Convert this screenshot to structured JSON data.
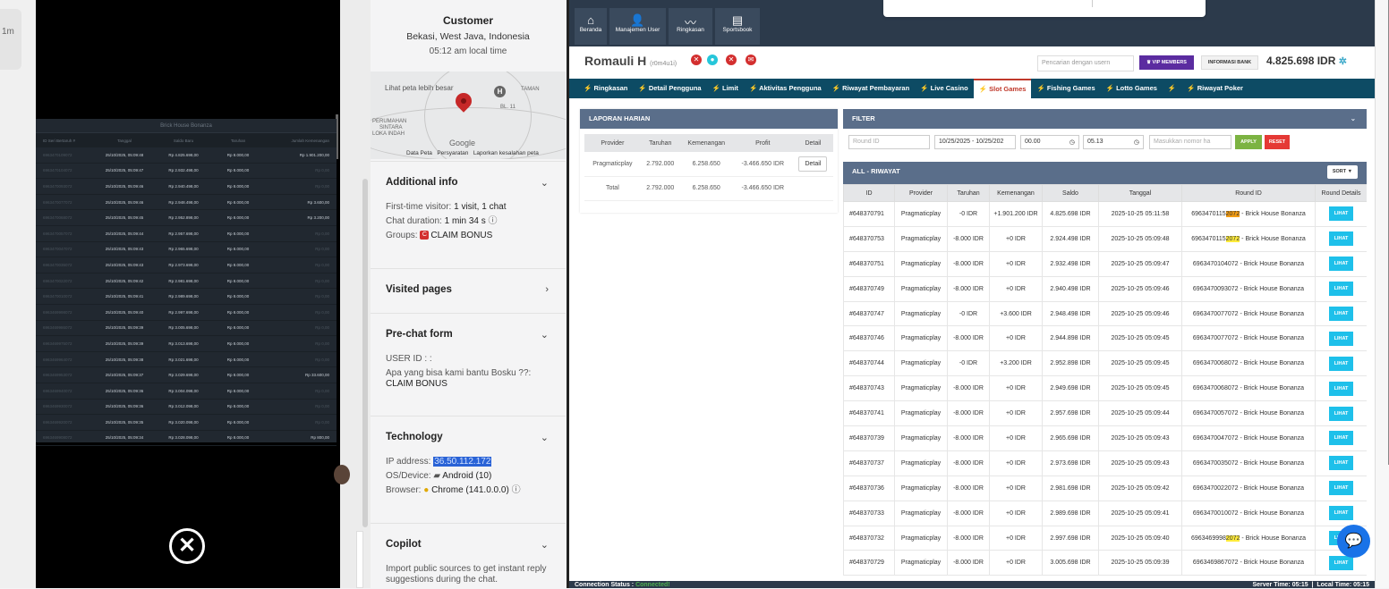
{
  "left_strip": {
    "label": "1m"
  },
  "viewer": {
    "sheet_title": "Brick House Bonanza",
    "headers": [
      "ID Seri Bertaruh #",
      "Tanggal",
      "Saldo Baru",
      "Taruhan",
      "Jumlah Kemenangan"
    ],
    "rows": [
      [
        "6963470109072",
        "25/10/2025, 05:09:48",
        "Rp 4.825.698,00",
        "Rp 8.000,00",
        "Rp 1.901.200,00"
      ],
      [
        "6963470104072",
        "25/10/2025, 05:09:47",
        "Rp 2.932.498,00",
        "Rp 8.000,00",
        "Rp 0,00"
      ],
      [
        "6963470093072",
        "25/10/2025, 05:09:46",
        "Rp 2.940.498,00",
        "Rp 8.000,00",
        "Rp 0,00"
      ],
      [
        "6963470077072",
        "25/10/2025, 05:09:46",
        "Rp 2.948.498,00",
        "Rp 8.000,00",
        "Rp 3.600,00"
      ],
      [
        "6963470068072",
        "25/10/2025, 05:09:45",
        "Rp 2.952.898,00",
        "Rp 8.000,00",
        "Rp 3.200,00"
      ],
      [
        "6963470057072",
        "25/10/2025, 05:09:44",
        "Rp 2.957.698,00",
        "Rp 8.000,00",
        "Rp 0,00"
      ],
      [
        "6963470047072",
        "25/10/2025, 05:09:43",
        "Rp 2.965.698,00",
        "Rp 8.000,00",
        "Rp 0,00"
      ],
      [
        "6963470035072",
        "25/10/2025, 05:09:43",
        "Rp 2.973.698,00",
        "Rp 8.000,00",
        "Rp 0,00"
      ],
      [
        "6963470022072",
        "25/10/2025, 05:09:42",
        "Rp 2.981.698,00",
        "Rp 8.000,00",
        "Rp 0,00"
      ],
      [
        "6963470010072",
        "25/10/2025, 05:09:41",
        "Rp 2.989.698,00",
        "Rp 8.000,00",
        "Rp 0,00"
      ],
      [
        "6963469998072",
        "25/10/2025, 05:09:40",
        "Rp 2.997.698,00",
        "Rp 8.000,00",
        "Rp 0,00"
      ],
      [
        "6963469986072",
        "25/10/2025, 05:09:39",
        "Rp 3.005.698,00",
        "Rp 8.000,00",
        "Rp 0,00"
      ],
      [
        "6963469975072",
        "25/10/2025, 05:09:39",
        "Rp 3.013.698,00",
        "Rp 8.000,00",
        "Rp 0,00"
      ],
      [
        "6963469964072",
        "25/10/2025, 05:09:38",
        "Rp 3.021.698,00",
        "Rp 8.000,00",
        "Rp 0,00"
      ],
      [
        "6963469953072",
        "25/10/2025, 05:09:37",
        "Rp 3.029.698,00",
        "Rp 8.000,00",
        "Rp 33.600,00"
      ],
      [
        "6963469940072",
        "25/10/2025, 05:09:36",
        "Rp 3.004.098,00",
        "Rp 8.000,00",
        "Rp 0,00"
      ],
      [
        "6963469930072",
        "25/10/2025, 05:09:36",
        "Rp 3.012.098,00",
        "Rp 8.000,00",
        "Rp 0,00"
      ],
      [
        "6963469920072",
        "25/10/2025, 05:09:35",
        "Rp 3.020.098,00",
        "Rp 8.000,00",
        "Rp 0,00"
      ],
      [
        "6963469908072",
        "25/10/2025, 05:09:34",
        "Rp 3.028.098,00",
        "Rp 8.000,00",
        "Rp 800,00"
      ]
    ],
    "close_glyph": "✕"
  },
  "visitor": {
    "name": "Customer",
    "location": "Bekasi, West Java, Indonesia",
    "local_time": "05:12 am local time",
    "map": {
      "link": "Lihat peta lebih besar",
      "labels": [
        "TAMAN",
        "BL. 11",
        "PERUMAHAN",
        "SINTARA",
        "LOKA INDAH"
      ],
      "google": "Google",
      "footer": [
        "Data Peta",
        "Persyaratan",
        "Laporkan kesalahan peta"
      ]
    },
    "additional": {
      "title": "Additional info",
      "first_label": "First-time visitor:",
      "first_value": "1 visit, 1 chat",
      "duration_label": "Chat duration:",
      "duration_value": "1 min 34 s",
      "groups_label": "Groups:",
      "groups_value": "CLAIM BONUS"
    },
    "visited": {
      "title": "Visited pages"
    },
    "prechat": {
      "title": "Pre-chat form",
      "user_id": "USER ID : :",
      "question": "Apa yang bisa kami bantu Bosku ??:",
      "answer": "CLAIM BONUS"
    },
    "technology": {
      "title": "Technology",
      "ip_label": "IP address:",
      "ip_value": "36.50.112.172",
      "os_label": "OS/Device:",
      "os_value": "Android (10)",
      "browser_label": "Browser:",
      "browser_value": "Chrome (141.0.0.0)"
    },
    "copilot": {
      "title": "Copilot",
      "text": "Import public sources to get instant reply suggestions during the chat."
    }
  },
  "admin": {
    "nav": [
      {
        "label": "Beranda",
        "icon": "⌂"
      },
      {
        "label": "Manajemen User",
        "icon": "👤"
      },
      {
        "label": "Ringkasan",
        "icon": "〰"
      },
      {
        "label": "Sportsbook",
        "icon": "▤"
      }
    ],
    "user": {
      "name": "Romauli H",
      "username": "(r0m4u1i)"
    },
    "search_placeholder": "Pencarian dengan usern",
    "vip_label": "VIP MEMBERS",
    "bank_label": "INFORMASI BANK",
    "balance": "4.825.698 IDR",
    "tabs": [
      "Ringkasan",
      "Detail Pengguna",
      "Limit",
      "Aktivitas Pengguna",
      "Riwayat Pembayaran",
      "Live Casino",
      "Slot Games",
      "Fishing Games",
      "Lotto Games",
      "",
      "Riwayat Poker"
    ],
    "active_tab": "Slot Games",
    "laporan": {
      "title": "LAPORAN HARIAN",
      "headers": [
        "Provider",
        "Taruhan",
        "Kemenangan",
        "Profit",
        "Detail"
      ],
      "row": {
        "provider": "Pragmaticplay",
        "taruhan": "2.792.000",
        "kemenangan": "6.258.650",
        "profit": "-3.466.650 IDR",
        "detail": "Detail"
      },
      "total": {
        "label": "Total",
        "taruhan": "2.792.000",
        "kemenangan": "6.258.650",
        "profit": "-3.466.650 IDR"
      }
    },
    "filter": {
      "title": "FILTER",
      "round_placeholder": "Round ID",
      "date_range": "10/25/2025 - 10/25/202",
      "time_from": "00.00",
      "time_to": "05.13",
      "nomor_placeholder": "Masukkan nomor ha",
      "apply": "APPLY",
      "reset": "RESET"
    },
    "riwayat": {
      "title": "ALL - RIWAYAT",
      "sort": "SORT",
      "headers": [
        "ID",
        "Provider",
        "Taruhan",
        "Kemenangan",
        "Saldo",
        "Tanggal",
        "Round ID",
        "Round Details"
      ],
      "button": "LIHAT",
      "rows": [
        {
          "id": "#648370791",
          "provider": "Pragmaticplay",
          "taruhan": "-0 IDR",
          "menang": "+1.901.200 IDR",
          "saldo": "4.825.698 IDR",
          "tanggal": "2025-10-25 05:11:58",
          "round_a": "6963470115",
          "round_hl": "2072",
          "round_b": " - Brick House Bonanza",
          "hl": "orange"
        },
        {
          "id": "#648370753",
          "provider": "Pragmaticplay",
          "taruhan": "-8.000 IDR",
          "menang": "+0 IDR",
          "saldo": "2.924.498 IDR",
          "tanggal": "2025-10-25 05:09:48",
          "round_a": "6963470115",
          "round_hl": "2072",
          "round_b": " - Brick House Bonanza",
          "hl": "yellow"
        },
        {
          "id": "#648370751",
          "provider": "Pragmaticplay",
          "taruhan": "-8.000 IDR",
          "menang": "+0 IDR",
          "saldo": "2.932.498 IDR",
          "tanggal": "2025-10-25 05:09:47",
          "round_a": "6963470104072",
          "round_hl": "",
          "round_b": " - Brick House Bonanza",
          "hl": ""
        },
        {
          "id": "#648370749",
          "provider": "Pragmaticplay",
          "taruhan": "-8.000 IDR",
          "menang": "+0 IDR",
          "saldo": "2.940.498 IDR",
          "tanggal": "2025-10-25 05:09:46",
          "round_a": "6963470093072",
          "round_hl": "",
          "round_b": " - Brick House Bonanza",
          "hl": ""
        },
        {
          "id": "#648370747",
          "provider": "Pragmaticplay",
          "taruhan": "-0 IDR",
          "menang": "+3.600 IDR",
          "saldo": "2.948.498 IDR",
          "tanggal": "2025-10-25 05:09:46",
          "round_a": "6963470077072",
          "round_hl": "",
          "round_b": " - Brick House Bonanza",
          "hl": ""
        },
        {
          "id": "#648370746",
          "provider": "Pragmaticplay",
          "taruhan": "-8.000 IDR",
          "menang": "+0 IDR",
          "saldo": "2.944.898 IDR",
          "tanggal": "2025-10-25 05:09:45",
          "round_a": "6963470077072",
          "round_hl": "",
          "round_b": " - Brick House Bonanza",
          "hl": ""
        },
        {
          "id": "#648370744",
          "provider": "Pragmaticplay",
          "taruhan": "-0 IDR",
          "menang": "+3.200 IDR",
          "saldo": "2.952.898 IDR",
          "tanggal": "2025-10-25 05:09:45",
          "round_a": "6963470068072",
          "round_hl": "",
          "round_b": " - Brick House Bonanza",
          "hl": ""
        },
        {
          "id": "#648370743",
          "provider": "Pragmaticplay",
          "taruhan": "-8.000 IDR",
          "menang": "+0 IDR",
          "saldo": "2.949.698 IDR",
          "tanggal": "2025-10-25 05:09:45",
          "round_a": "6963470068072",
          "round_hl": "",
          "round_b": " - Brick House Bonanza",
          "hl": ""
        },
        {
          "id": "#648370741",
          "provider": "Pragmaticplay",
          "taruhan": "-8.000 IDR",
          "menang": "+0 IDR",
          "saldo": "2.957.698 IDR",
          "tanggal": "2025-10-25 05:09:44",
          "round_a": "6963470057072",
          "round_hl": "",
          "round_b": " - Brick House Bonanza",
          "hl": ""
        },
        {
          "id": "#648370739",
          "provider": "Pragmaticplay",
          "taruhan": "-8.000 IDR",
          "menang": "+0 IDR",
          "saldo": "2.965.698 IDR",
          "tanggal": "2025-10-25 05:09:43",
          "round_a": "6963470047072",
          "round_hl": "",
          "round_b": " - Brick House Bonanza",
          "hl": ""
        },
        {
          "id": "#648370737",
          "provider": "Pragmaticplay",
          "taruhan": "-8.000 IDR",
          "menang": "+0 IDR",
          "saldo": "2.973.698 IDR",
          "tanggal": "2025-10-25 05:09:43",
          "round_a": "6963470035072",
          "round_hl": "",
          "round_b": " - Brick House Bonanza",
          "hl": ""
        },
        {
          "id": "#648370736",
          "provider": "Pragmaticplay",
          "taruhan": "-8.000 IDR",
          "menang": "+0 IDR",
          "saldo": "2.981.698 IDR",
          "tanggal": "2025-10-25 05:09:42",
          "round_a": "6963470022072",
          "round_hl": "",
          "round_b": " - Brick House Bonanza",
          "hl": ""
        },
        {
          "id": "#648370733",
          "provider": "Pragmaticplay",
          "taruhan": "-8.000 IDR",
          "menang": "+0 IDR",
          "saldo": "2.989.698 IDR",
          "tanggal": "2025-10-25 05:09:41",
          "round_a": "6963470010072",
          "round_hl": "",
          "round_b": " - Brick House Bonanza",
          "hl": ""
        },
        {
          "id": "#648370732",
          "provider": "Pragmaticplay",
          "taruhan": "-8.000 IDR",
          "menang": "+0 IDR",
          "saldo": "2.997.698 IDR",
          "tanggal": "2025-10-25 05:09:40",
          "round_a": "6963469998",
          "round_hl": "2072",
          "round_b": " - Brick House Bonanza",
          "hl": "yellow"
        },
        {
          "id": "#648370729",
          "provider": "Pragmaticplay",
          "taruhan": "-8.000 IDR",
          "menang": "+0 IDR",
          "saldo": "3.005.698 IDR",
          "tanggal": "2025-10-25 05:09:39",
          "round_a": "6963469867072",
          "round_hl": "",
          "round_b": " - Brick House Bonanza",
          "hl": ""
        }
      ]
    },
    "status": {
      "label": "Connection Status :",
      "value": "Connected!",
      "server": "Server Time: 05:15",
      "local": "Local Time: 05:15"
    }
  },
  "colors": {
    "nav_bg": "#2c3a4b",
    "tab_bg": "#0d4b64",
    "panel_head": "#5a6e8a",
    "lihat": "#1ec0ea",
    "vip": "#5b2ca0",
    "ip_highlight": "#2962d6"
  }
}
